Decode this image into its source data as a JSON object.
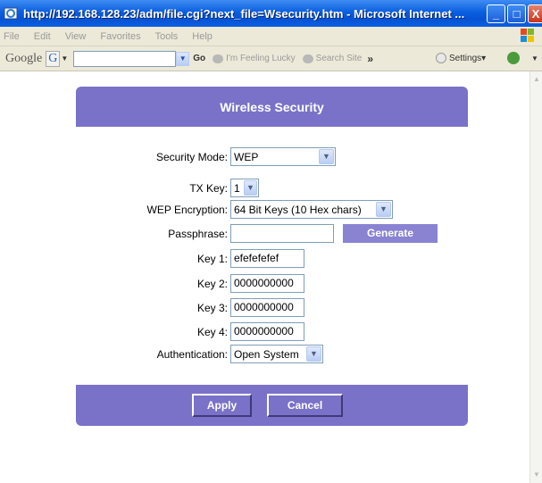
{
  "window": {
    "title": "http://192.168.128.23/adm/file.cgi?next_file=Wsecurity.htm - Microsoft Internet ...",
    "minimize_glyph": "_",
    "maximize_glyph": "□",
    "close_glyph": "X"
  },
  "menu": {
    "items": [
      "File",
      "Edit",
      "View",
      "Favorites",
      "Tools",
      "Help"
    ]
  },
  "google_toolbar": {
    "logo": "Google",
    "g_button": "G",
    "go_label": "Go",
    "feeling_lucky": "I'm Feeling Lucky",
    "search_site": "Search Site",
    "more": "»",
    "settings": "Settings▾"
  },
  "page": {
    "header_title": "Wireless Security",
    "security_mode": {
      "label": "Security Mode:",
      "value": "WEP"
    },
    "tx_key": {
      "label": "TX Key:",
      "value": "1"
    },
    "wep_encryption": {
      "label": "WEP Encryption:",
      "value": "64 Bit Keys (10 Hex chars)"
    },
    "passphrase": {
      "label": "Passphrase:",
      "value": "",
      "generate_label": "Generate"
    },
    "key1": {
      "label": "Key 1:",
      "value": "efefefefef"
    },
    "key2": {
      "label": "Key 2:",
      "value": "0000000000"
    },
    "key3": {
      "label": "Key 3:",
      "value": "0000000000"
    },
    "key4": {
      "label": "Key 4:",
      "value": "0000000000"
    },
    "authentication": {
      "label": "Authentication:",
      "value": "Open System"
    },
    "apply_label": "Apply",
    "cancel_label": "Cancel"
  },
  "colors": {
    "panel": "#7a72c8",
    "titlebar": "#0a5fe0",
    "chrome": "#ece9d8"
  }
}
